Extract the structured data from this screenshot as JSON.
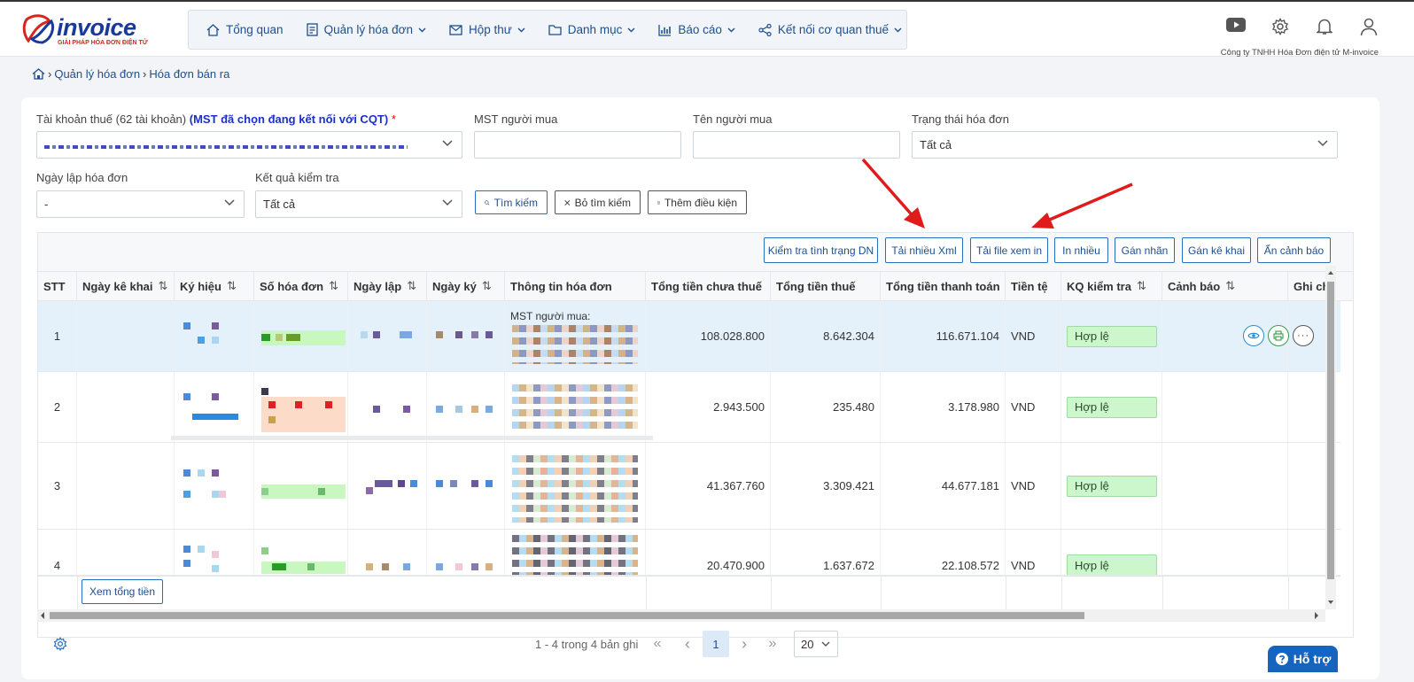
{
  "brand": {
    "logo_text": "invoice",
    "tagline": "GIẢI PHÁP HÓA ĐƠN ĐIỆN TỬ"
  },
  "nav": [
    {
      "label": "Tổng quan",
      "icon": "home-icon"
    },
    {
      "label": "Quản lý hóa đơn",
      "icon": "document-icon"
    },
    {
      "label": "Hộp thư",
      "icon": "mail-icon"
    },
    {
      "label": "Danh mục",
      "icon": "folder-icon"
    },
    {
      "label": "Báo cáo",
      "icon": "chart-icon"
    },
    {
      "label": "Kết nối cơ quan thuế",
      "icon": "share-icon"
    }
  ],
  "header": {
    "company": "Công ty TNHH Hóa Đơn điện tử M-invoice"
  },
  "breadcrumb": {
    "level1": "Quản lý hóa đơn",
    "level2": "Hóa đơn bán ra"
  },
  "filters": {
    "tax_account_label": "Tài khoản thuế (62 tài khoản)",
    "tax_account_note": "(MST đã chọn đang kết nối với CQT)",
    "tax_account_required": "*",
    "buyer_tax_label": "MST người mua",
    "buyer_name_label": "Tên người mua",
    "status_label": "Trạng thái hóa đơn",
    "status_value": "Tất cả",
    "date_label": "Ngày lập hóa đơn",
    "date_value": "-",
    "check_label": "Kết quả kiểm tra",
    "check_value": "Tất cả",
    "search_btn": "Tìm kiếm",
    "clear_btn": "Bỏ tìm kiếm",
    "add_cond_btn": "Thêm điều kiện"
  },
  "toolbar": {
    "check_status": "Kiểm tra tình trạng DN",
    "download_xml": "Tải nhiều Xml",
    "download_view": "Tải file xem in",
    "print_many": "In nhiều",
    "assign_label": "Gán nhãn",
    "assign_declare": "Gán kê khai",
    "hide_warning": "Ẩn cảnh báo"
  },
  "columns": [
    "STT",
    "Ngày kê khai",
    "Ký hiệu",
    "Số hóa đơn",
    "Ngày lập",
    "Ngày ký",
    "Thông tin hóa đơn",
    "Tổng tiền chưa thuế",
    "Tổng tiền thuế",
    "Tổng tiền thanh toán",
    "Tiền tệ",
    "KQ kiểm tra",
    "Cảnh báo",
    "Ghi ch"
  ],
  "rows": [
    {
      "stt": "1",
      "info_label": "MST người mua:",
      "pretax": "108.028.800",
      "tax": "8.642.304",
      "total": "116.671.104",
      "currency": "VND",
      "check": "Hợp lệ"
    },
    {
      "stt": "2",
      "info_label": "",
      "pretax": "2.943.500",
      "tax": "235.480",
      "total": "3.178.980",
      "currency": "VND",
      "check": "Hợp lệ"
    },
    {
      "stt": "3",
      "info_label": "",
      "pretax": "41.367.760",
      "tax": "3.309.421",
      "total": "44.677.181",
      "currency": "VND",
      "check": "Hợp lệ"
    },
    {
      "stt": "4",
      "info_label": "",
      "pretax": "20.470.900",
      "tax": "1.637.672",
      "total": "22.108.572",
      "currency": "VND",
      "check": "Hợp lệ"
    }
  ],
  "footer": {
    "sum_btn": "Xem tổng tiền"
  },
  "pagination": {
    "summary": "1 - 4 trong 4 bản ghi",
    "first": "«",
    "prev": "‹",
    "current": "1",
    "next": "›",
    "last": "»",
    "page_size": "20"
  },
  "help": {
    "label": "Hỗ trợ"
  },
  "colors": {
    "primary": "#1e4f8f",
    "accent_red": "#e01b1b",
    "valid_bg": "#ccf7cc",
    "selected_row": "#e4f1fb"
  }
}
